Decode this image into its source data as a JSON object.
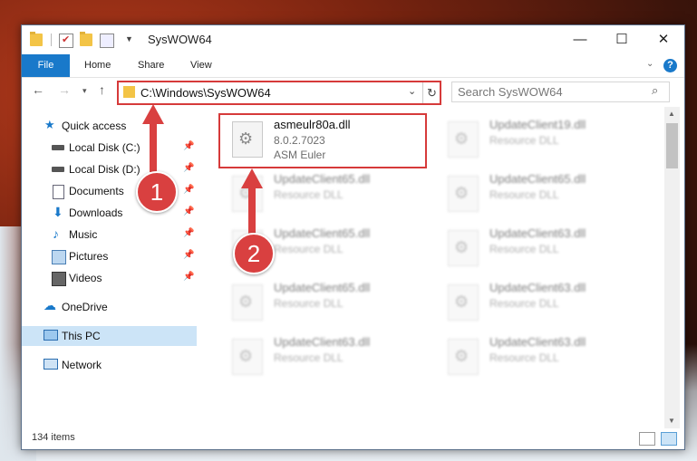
{
  "window": {
    "title": "SysWOW64",
    "controls": {
      "minimize": "—",
      "maximize": "☐",
      "close": "✕"
    }
  },
  "ribbon": {
    "tabs": [
      "File",
      "Home",
      "Share",
      "View"
    ],
    "help": "?"
  },
  "address": {
    "path": "C:\\Windows\\SysWOW64"
  },
  "search": {
    "placeholder": "Search SysWOW64"
  },
  "sidebar": {
    "items": [
      {
        "label": "Quick access",
        "icon": "star-icon"
      },
      {
        "label": "Local Disk (C:)",
        "icon": "drive-icon",
        "pinned": true
      },
      {
        "label": "Local Disk (D:)",
        "icon": "drive-icon",
        "pinned": true
      },
      {
        "label": "Documents",
        "icon": "documents-icon",
        "pinned": true
      },
      {
        "label": "Downloads",
        "icon": "downloads-icon",
        "pinned": true
      },
      {
        "label": "Music",
        "icon": "music-icon",
        "pinned": true
      },
      {
        "label": "Pictures",
        "icon": "pictures-icon",
        "pinned": true
      },
      {
        "label": "Videos",
        "icon": "videos-icon",
        "pinned": true
      },
      {
        "label": "OneDrive",
        "icon": "onedrive-icon"
      },
      {
        "label": "This PC",
        "icon": "pc-icon",
        "selected": true
      },
      {
        "label": "Network",
        "icon": "network-icon"
      }
    ]
  },
  "files": [
    {
      "name": "asmeulr80a.dll",
      "version": "8.0.2.7023",
      "company": "ASM Euler"
    },
    {
      "name": "UpdateClient19.dll",
      "type": "Resource DLL"
    },
    {
      "name": "UpdateClient65.dll",
      "type": "Resource DLL"
    },
    {
      "name": "UpdateClient65.dll",
      "type": "Resource DLL"
    },
    {
      "name": "UpdateClient65.dll",
      "type": "Resource DLL"
    },
    {
      "name": "UpdateClient63.dll",
      "type": "Resource DLL"
    },
    {
      "name": "UpdateClient65.dll",
      "type": "Resource DLL"
    },
    {
      "name": "UpdateClient63.dll",
      "type": "Resource DLL"
    },
    {
      "name": "UpdateClient63.dll",
      "type": "Resource DLL"
    },
    {
      "name": "UpdateClient63.dll",
      "type": "Resource DLL"
    }
  ],
  "status": {
    "count": "134 items"
  },
  "callouts": {
    "one": "1",
    "two": "2"
  },
  "colors": {
    "accent": "#1979ca",
    "callout": "#d94040",
    "selected": "#cce4f7"
  }
}
